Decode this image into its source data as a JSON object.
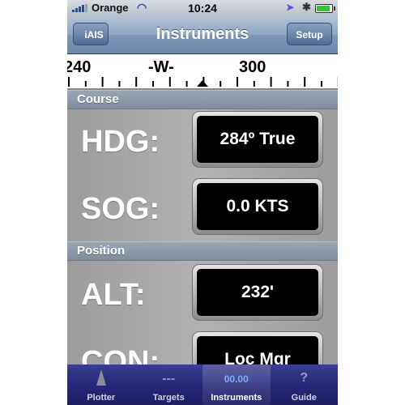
{
  "status_bar": {
    "carrier": "Orange",
    "time": "10:24",
    "icons": [
      "signal-bars-icon",
      "wifi-icon",
      "location-arrow-icon",
      "bluetooth-icon",
      "battery-icon"
    ]
  },
  "nav": {
    "title": "Instruments",
    "back_label": "iAIS",
    "setup_label": "Setup"
  },
  "compass": {
    "left_label": "240",
    "mid_label": "-W-",
    "right_label": "300",
    "heading": 284
  },
  "sections": {
    "course": "Course",
    "position": "Position"
  },
  "rows": {
    "hdg": {
      "label": "HDG:",
      "value": "284º True"
    },
    "sog": {
      "label": "SOG:",
      "value": "0.0 KTS"
    },
    "alt": {
      "label": "ALT:",
      "value": "232'"
    },
    "con": {
      "label": "CON:",
      "value": "Loc Mgr"
    }
  },
  "tabs": [
    {
      "label": "Plotter",
      "icon": "boat-icon"
    },
    {
      "label": "Targets",
      "icon": "dashes-icon",
      "glyph": "---"
    },
    {
      "label": "Instruments",
      "icon": "digits-icon",
      "glyph": "00.00",
      "active": true
    },
    {
      "label": "Guide",
      "icon": "question-icon",
      "glyph": "?"
    }
  ]
}
